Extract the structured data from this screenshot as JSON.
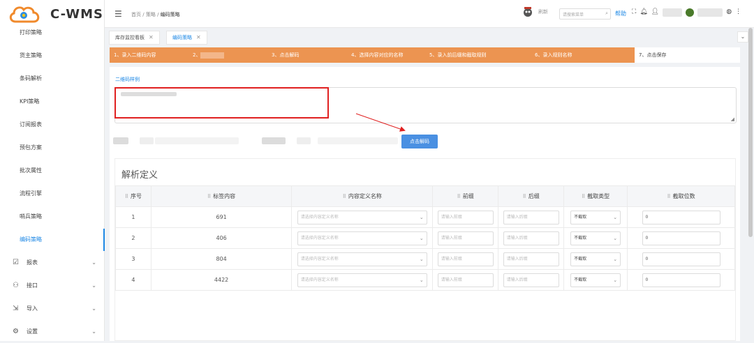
{
  "app": {
    "logo_text": "C-WMS"
  },
  "sidebar": {
    "items": [
      {
        "label": "打印策略"
      },
      {
        "label": "货主策略"
      },
      {
        "label": "条码解析"
      },
      {
        "label": "KPI策略"
      },
      {
        "label": "订阅报表"
      },
      {
        "label": "预包方案"
      },
      {
        "label": "批次属性"
      },
      {
        "label": "流程引擎"
      },
      {
        "label": "哨兵策略"
      },
      {
        "label": "编码策略"
      }
    ],
    "groups": [
      {
        "label": "报表"
      },
      {
        "label": "接口"
      },
      {
        "label": "导入"
      },
      {
        "label": "设置"
      }
    ]
  },
  "header": {
    "breadcrumb": [
      "首页",
      "策略",
      "编码策略"
    ],
    "refresh_label": "刷新",
    "search_placeholder": "请搜索菜单",
    "help_label": "帮助"
  },
  "tabs": [
    {
      "label": "库存监控看板"
    },
    {
      "label": "编码策略"
    }
  ],
  "steps": [
    {
      "label": "1、录入二维码内容"
    },
    {
      "label": "2、"
    },
    {
      "label": "3、点击解码"
    },
    {
      "label": "4、选择内容对应的名称"
    },
    {
      "label": "5、录入前后缀和截取规则"
    },
    {
      "label": "6、录入规则名称"
    },
    {
      "label": "7、点击保存"
    }
  ],
  "form": {
    "example_label": "二维码样例",
    "decode_button": "点击解码"
  },
  "definition": {
    "title": "解析定义",
    "columns": [
      "序号",
      "标签内容",
      "内容定义名称",
      "前缀",
      "后缀",
      "截取类型",
      "截取位数"
    ],
    "rows": [
      {
        "index": "1",
        "content": "691",
        "name_placeholder": "请选择内容定义名称",
        "prefix_placeholder": "请输入前缀",
        "suffix_placeholder": "请输入后缀",
        "cut_type": "不截取",
        "cut_digits": "0"
      },
      {
        "index": "2",
        "content": "406",
        "name_placeholder": "请选择内容定义名称",
        "prefix_placeholder": "请输入前缀",
        "suffix_placeholder": "请输入后缀",
        "cut_type": "不截取",
        "cut_digits": "0"
      },
      {
        "index": "3",
        "content": "804",
        "name_placeholder": "请选择内容定义名称",
        "prefix_placeholder": "请输入前缀",
        "suffix_placeholder": "请输入后缀",
        "cut_type": "不截取",
        "cut_digits": "0"
      },
      {
        "index": "4",
        "content": "4422",
        "name_placeholder": "请选择内容定义名称",
        "prefix_placeholder": "请输入前缀",
        "suffix_placeholder": "请输入后缀",
        "cut_type": "不截取",
        "cut_digits": "0"
      }
    ]
  },
  "colors": {
    "accent": "#1e88e5",
    "steps_bg": "#ec9451",
    "highlight": "#e02020",
    "button": "#4a90e2"
  }
}
